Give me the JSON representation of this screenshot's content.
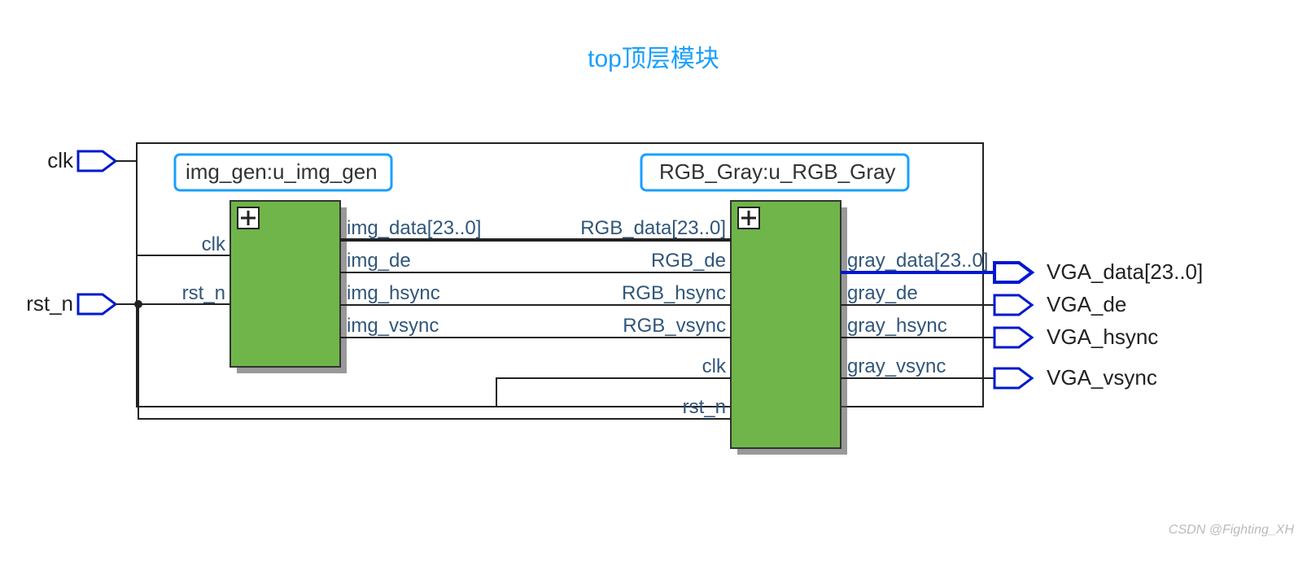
{
  "title": "top顶层模块",
  "watermark": "CSDN @Fighting_XH",
  "inputs": {
    "clk": "clk",
    "rst_n": "rst_n"
  },
  "block1": {
    "instance": "img_gen:u_img_gen",
    "in_ports": {
      "clk": "clk",
      "rst_n": "rst_n"
    },
    "out_ports": {
      "img_data": "img_data[23..0]",
      "img_de": "img_de",
      "img_hsync": "img_hsync",
      "img_vsync": "img_vsync"
    }
  },
  "block2": {
    "instance": "RGB_Gray:u_RGB_Gray",
    "in_ports": {
      "rgb_data": "RGB_data[23..0]",
      "rgb_de": "RGB_de",
      "rgb_hsync": "RGB_hsync",
      "rgb_vsync": "RGB_vsync",
      "clk": "clk",
      "rst_n": "rst_n"
    },
    "out_ports": {
      "gray_data": "gray_data[23..0]",
      "gray_de": "gray_de",
      "gray_hsync": "gray_hsync",
      "gray_vsync": "gray_vsync"
    }
  },
  "outputs": {
    "vga_data": "VGA_data[23..0]",
    "vga_de": "VGA_de",
    "vga_hsync": "VGA_hsync",
    "vga_vsync": "VGA_vsync"
  }
}
